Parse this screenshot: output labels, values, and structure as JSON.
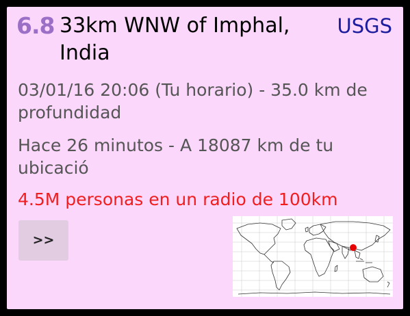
{
  "quake": {
    "magnitude": "6.8",
    "location": "33km WNW of Imphal, India",
    "source": "USGS",
    "time_depth": "03/01/16 20:06 (Tu horario) - 35.0 km de profundidad",
    "ago_distance": "Hace 26 minutos - A 18087 km de tu ubicació",
    "population": "4.5M personas en un radio de 100km"
  },
  "actions": {
    "more_label": ">>"
  },
  "colors": {
    "card_background": "#fcd7fc",
    "magnitude": "#9b6fc6",
    "source_link": "#1c1c9e",
    "population_alert": "#f01e1e",
    "epicenter_marker": "#e60000"
  },
  "map": {
    "icon": "world-map-icon",
    "marker_icon": "epicenter-dot-icon"
  }
}
